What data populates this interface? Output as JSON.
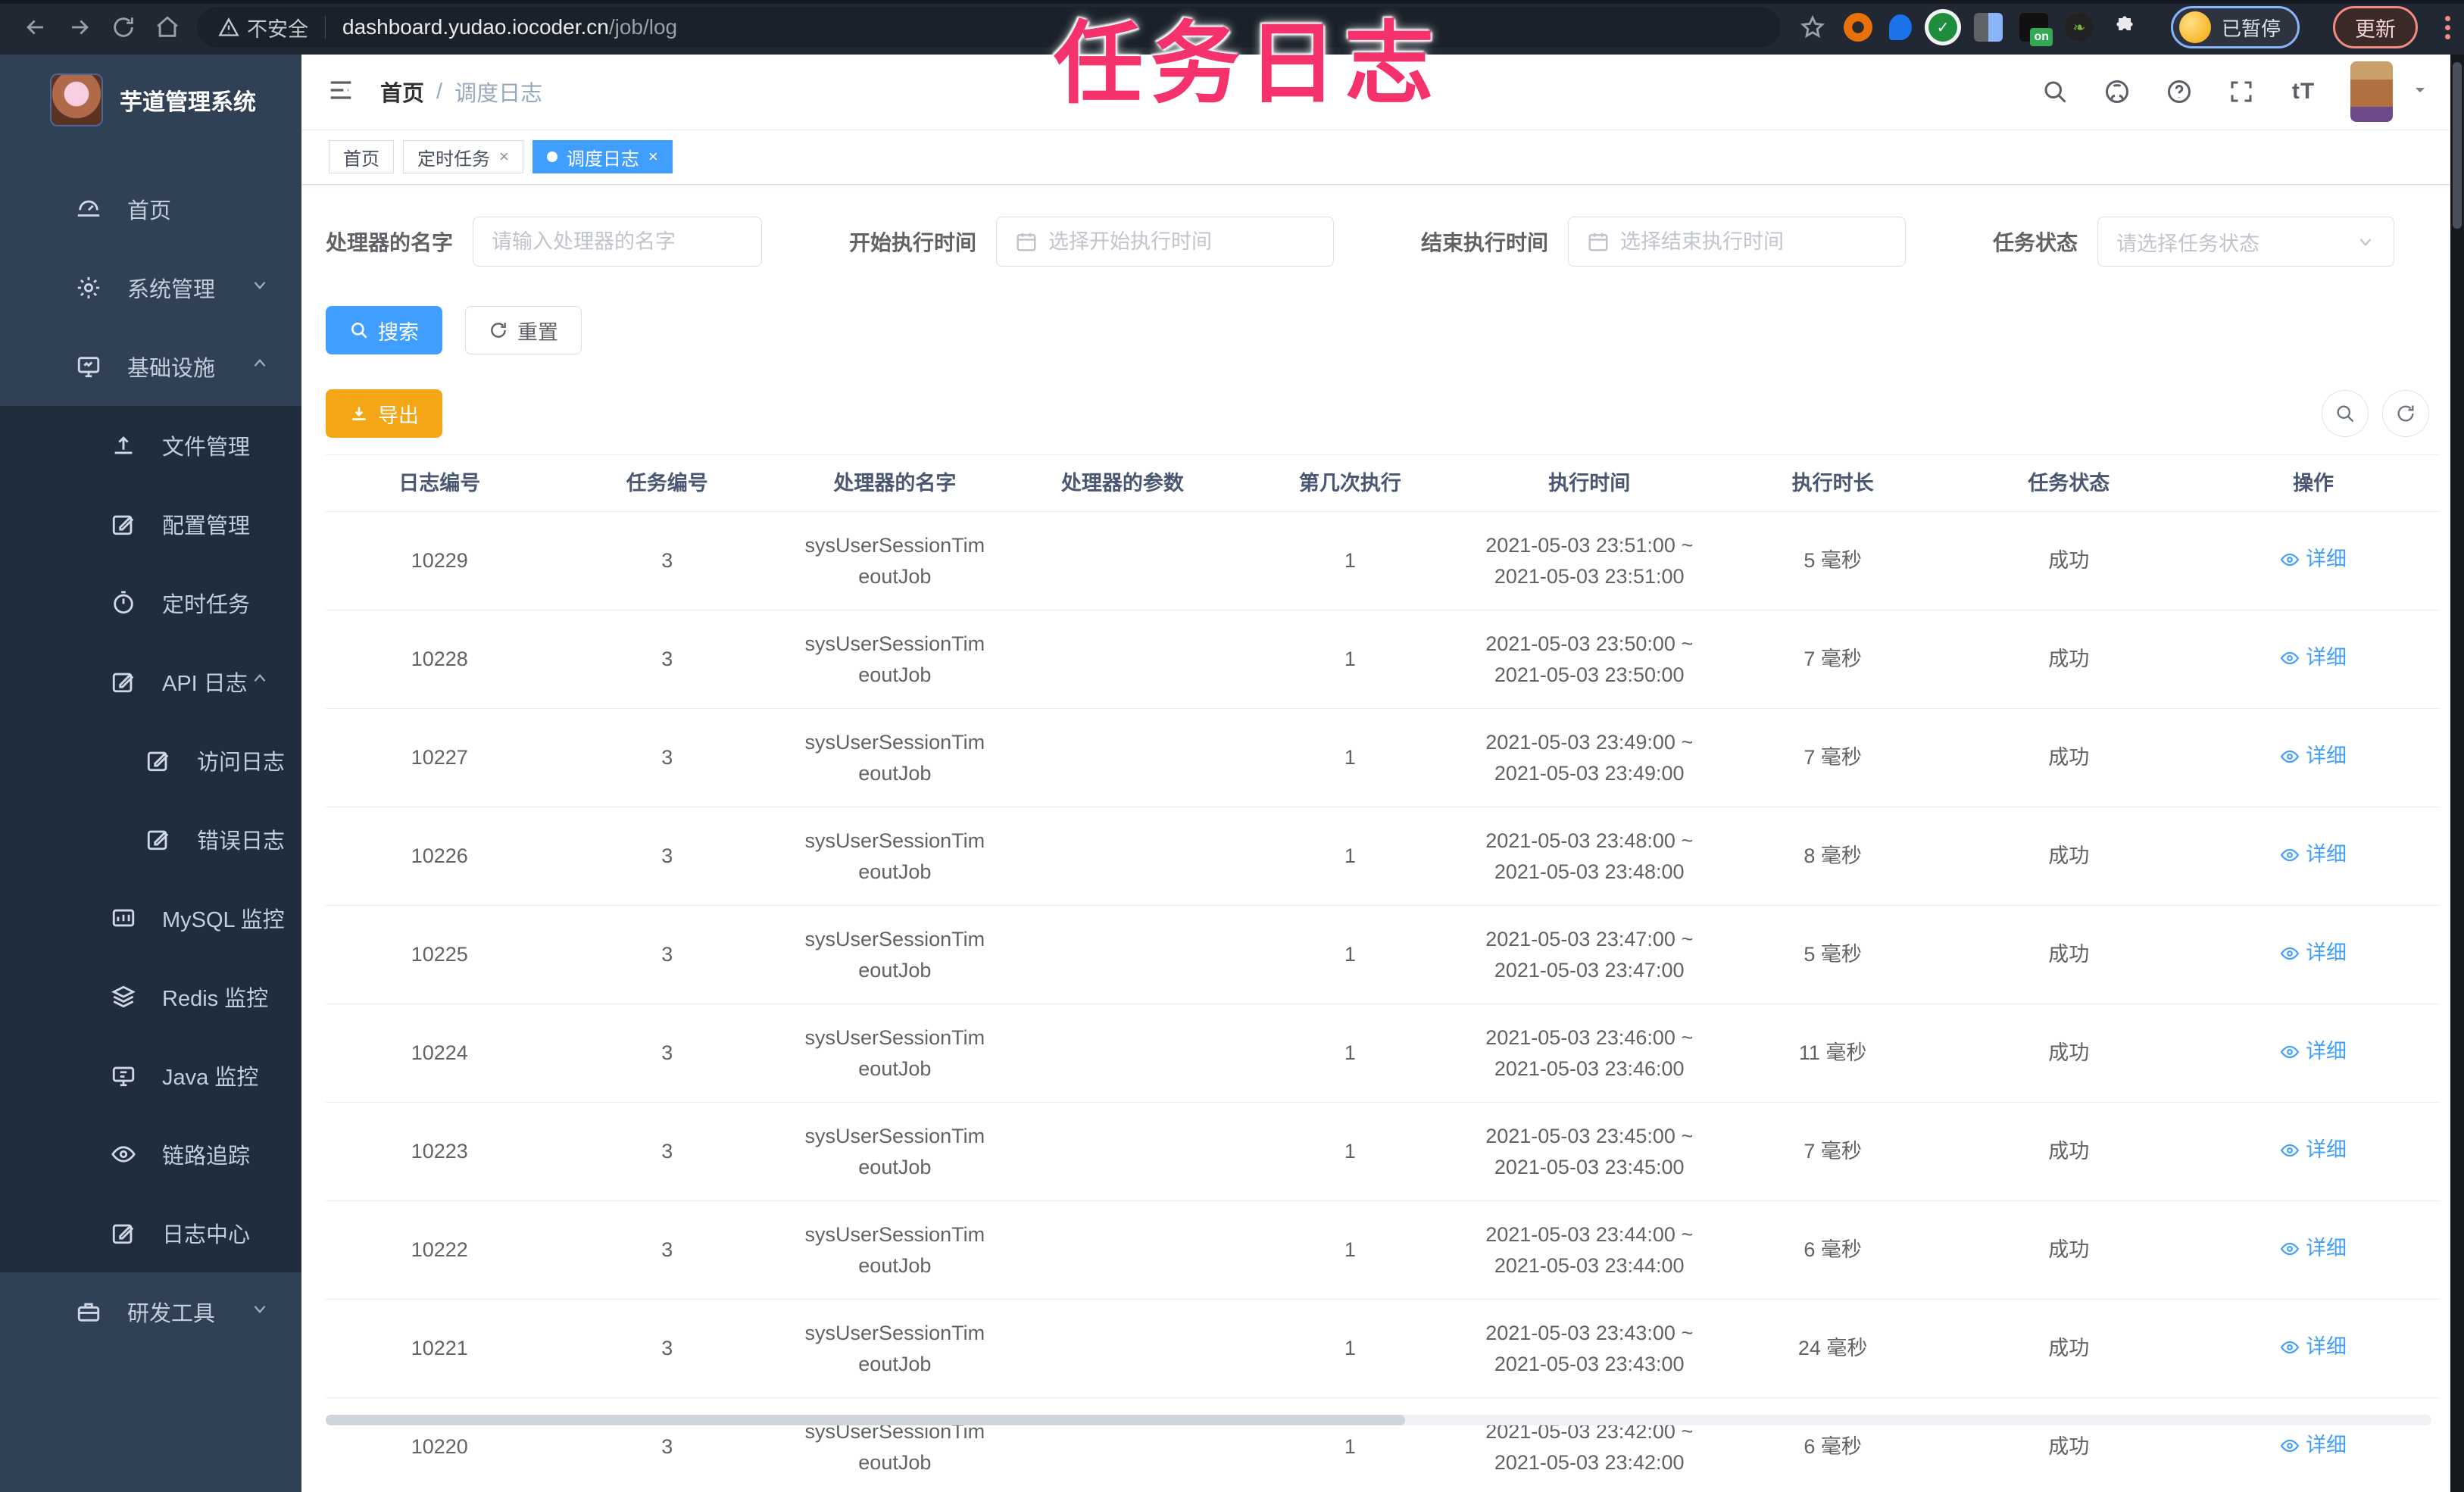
{
  "browser": {
    "security_label": "不安全",
    "url_host": "dashboard.yudao.iocoder.cn",
    "url_path": "/job/log",
    "on_badge": "on",
    "paused_badge": "已暂停",
    "update_button": "更新"
  },
  "watermark": "任务日志",
  "sidebar": {
    "title": "芋道管理系统",
    "items": [
      {
        "label": "首页",
        "icon": "dashboard-icon",
        "level": 0,
        "chevron": null,
        "sub": false
      },
      {
        "label": "系统管理",
        "icon": "gear-icon",
        "level": 0,
        "chevron": "down",
        "sub": false
      },
      {
        "label": "基础设施",
        "icon": "monitor-icon",
        "level": 0,
        "chevron": "up",
        "sub": false
      },
      {
        "label": "文件管理",
        "icon": "upload-icon",
        "level": 1,
        "chevron": null,
        "sub": true
      },
      {
        "label": "配置管理",
        "icon": "edit-icon",
        "level": 1,
        "chevron": null,
        "sub": true
      },
      {
        "label": "定时任务",
        "icon": "timer-icon",
        "level": 1,
        "chevron": null,
        "sub": true
      },
      {
        "label": "API 日志",
        "icon": "log-icon",
        "level": 1,
        "chevron": "up",
        "sub": true
      },
      {
        "label": "访问日志",
        "icon": "log-icon",
        "level": 2,
        "chevron": null,
        "sub": true
      },
      {
        "label": "错误日志",
        "icon": "log-icon",
        "level": 2,
        "chevron": null,
        "sub": true
      },
      {
        "label": "MySQL 监控",
        "icon": "database-icon",
        "level": 1,
        "chevron": null,
        "sub": true
      },
      {
        "label": "Redis 监控",
        "icon": "layers-icon",
        "level": 1,
        "chevron": null,
        "sub": true
      },
      {
        "label": "Java 监控",
        "icon": "java-icon",
        "level": 1,
        "chevron": null,
        "sub": true
      },
      {
        "label": "链路追踪",
        "icon": "eye-icon",
        "level": 1,
        "chevron": null,
        "sub": true
      },
      {
        "label": "日志中心",
        "icon": "log-icon",
        "level": 1,
        "chevron": null,
        "sub": true
      },
      {
        "label": "研发工具",
        "icon": "toolbox-icon",
        "level": 0,
        "chevron": "down",
        "sub": false
      }
    ]
  },
  "navbar": {
    "breadcrumb": [
      "首页",
      "调度日志"
    ],
    "separator": "/"
  },
  "tags": [
    {
      "label": "首页",
      "closable": false,
      "active": false
    },
    {
      "label": "定时任务",
      "closable": true,
      "active": false
    },
    {
      "label": "调度日志",
      "closable": true,
      "active": true
    }
  ],
  "filters": {
    "handler_label": "处理器的名字",
    "handler_placeholder": "请输入处理器的名字",
    "start_label": "开始执行时间",
    "start_placeholder": "选择开始执行时间",
    "end_label": "结束执行时间",
    "end_placeholder": "选择结束执行时间",
    "status_label": "任务状态",
    "status_placeholder": "请选择任务状态"
  },
  "actions": {
    "search": "搜索",
    "reset": "重置",
    "export": "导出"
  },
  "table": {
    "headers": [
      "日志编号",
      "任务编号",
      "处理器的名字",
      "处理器的参数",
      "第几次执行",
      "执行时间",
      "执行时长",
      "任务状态",
      "操作"
    ],
    "detail_label": "详细",
    "rows": [
      {
        "id": "10229",
        "task": "3",
        "handler": [
          "sysUserSessionTim",
          "eoutJob"
        ],
        "param": "",
        "nth": "1",
        "time": [
          "2021-05-03 23:51:00 ~",
          "2021-05-03 23:51:00"
        ],
        "duration": "5 毫秒",
        "status": "成功"
      },
      {
        "id": "10228",
        "task": "3",
        "handler": [
          "sysUserSessionTim",
          "eoutJob"
        ],
        "param": "",
        "nth": "1",
        "time": [
          "2021-05-03 23:50:00 ~",
          "2021-05-03 23:50:00"
        ],
        "duration": "7 毫秒",
        "status": "成功"
      },
      {
        "id": "10227",
        "task": "3",
        "handler": [
          "sysUserSessionTim",
          "eoutJob"
        ],
        "param": "",
        "nth": "1",
        "time": [
          "2021-05-03 23:49:00 ~",
          "2021-05-03 23:49:00"
        ],
        "duration": "7 毫秒",
        "status": "成功"
      },
      {
        "id": "10226",
        "task": "3",
        "handler": [
          "sysUserSessionTim",
          "eoutJob"
        ],
        "param": "",
        "nth": "1",
        "time": [
          "2021-05-03 23:48:00 ~",
          "2021-05-03 23:48:00"
        ],
        "duration": "8 毫秒",
        "status": "成功"
      },
      {
        "id": "10225",
        "task": "3",
        "handler": [
          "sysUserSessionTim",
          "eoutJob"
        ],
        "param": "",
        "nth": "1",
        "time": [
          "2021-05-03 23:47:00 ~",
          "2021-05-03 23:47:00"
        ],
        "duration": "5 毫秒",
        "status": "成功"
      },
      {
        "id": "10224",
        "task": "3",
        "handler": [
          "sysUserSessionTim",
          "eoutJob"
        ],
        "param": "",
        "nth": "1",
        "time": [
          "2021-05-03 23:46:00 ~",
          "2021-05-03 23:46:00"
        ],
        "duration": "11 毫秒",
        "status": "成功"
      },
      {
        "id": "10223",
        "task": "3",
        "handler": [
          "sysUserSessionTim",
          "eoutJob"
        ],
        "param": "",
        "nth": "1",
        "time": [
          "2021-05-03 23:45:00 ~",
          "2021-05-03 23:45:00"
        ],
        "duration": "7 毫秒",
        "status": "成功"
      },
      {
        "id": "10222",
        "task": "3",
        "handler": [
          "sysUserSessionTim",
          "eoutJob"
        ],
        "param": "",
        "nth": "1",
        "time": [
          "2021-05-03 23:44:00 ~",
          "2021-05-03 23:44:00"
        ],
        "duration": "6 毫秒",
        "status": "成功"
      },
      {
        "id": "10221",
        "task": "3",
        "handler": [
          "sysUserSessionTim",
          "eoutJob"
        ],
        "param": "",
        "nth": "1",
        "time": [
          "2021-05-03 23:43:00 ~",
          "2021-05-03 23:43:00"
        ],
        "duration": "24 毫秒",
        "status": "成功"
      },
      {
        "id": "10220",
        "task": "3",
        "handler": [
          "sysUserSessionTim",
          "eoutJob"
        ],
        "param": "",
        "nth": "1",
        "time": [
          "2021-05-03 23:42:00 ~",
          "2021-05-03 23:42:00"
        ],
        "duration": "6 毫秒",
        "status": "成功"
      }
    ]
  },
  "colors": {
    "accent": "#409eff",
    "warning": "#f5a617",
    "watermark": "#f5326b",
    "sidebar": "#304156",
    "submenu": "#1f2d3d"
  }
}
